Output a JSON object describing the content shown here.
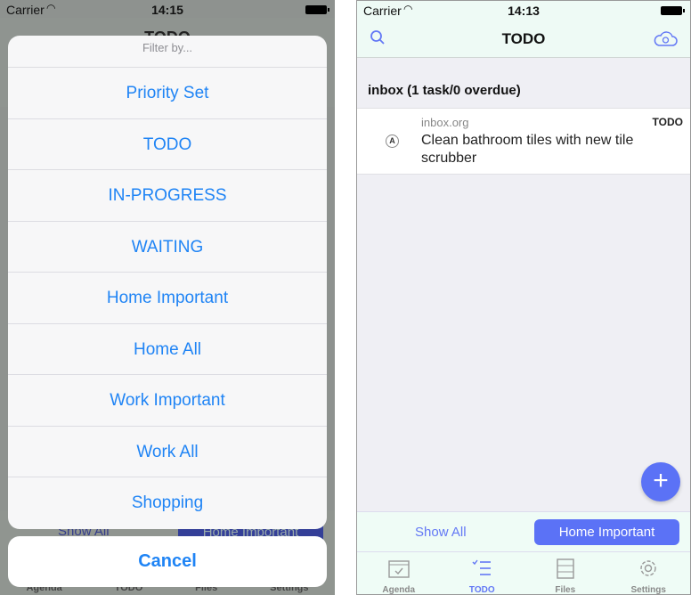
{
  "left": {
    "status": {
      "carrier": "Carrier",
      "time": "14:15"
    },
    "background": {
      "title": "TODO",
      "show_all": "Show All",
      "home_important": "Home Important",
      "tabs": [
        "Agenda",
        "TODO",
        "Files",
        "Settings"
      ]
    },
    "sheet": {
      "title": "Filter by...",
      "options": [
        "Priority Set",
        "TODO",
        "IN-PROGRESS",
        "WAITING",
        "Home Important",
        "Home All",
        "Work Important",
        "Work All",
        "Shopping"
      ],
      "cancel": "Cancel"
    }
  },
  "right": {
    "status": {
      "carrier": "Carrier",
      "time": "14:13"
    },
    "nav": {
      "title": "TODO",
      "left_icon": "search-icon",
      "right_icon": "cloud-sync-icon"
    },
    "section": "inbox (1 task/0 overdue)",
    "task": {
      "file": "inbox.org",
      "keyword": "TODO",
      "priority": "A",
      "title": "Clean bathroom tiles with new tile scrubber"
    },
    "fab": "+",
    "filters": {
      "show_all": "Show All",
      "home_important": "Home Important"
    },
    "tabs": [
      {
        "label": "Agenda",
        "icon": "calendar-icon"
      },
      {
        "label": "TODO",
        "icon": "checklist-icon",
        "active": true
      },
      {
        "label": "Files",
        "icon": "cabinet-icon"
      },
      {
        "label": "Settings",
        "icon": "gear-icon"
      }
    ],
    "accent": "#5b72f6"
  }
}
